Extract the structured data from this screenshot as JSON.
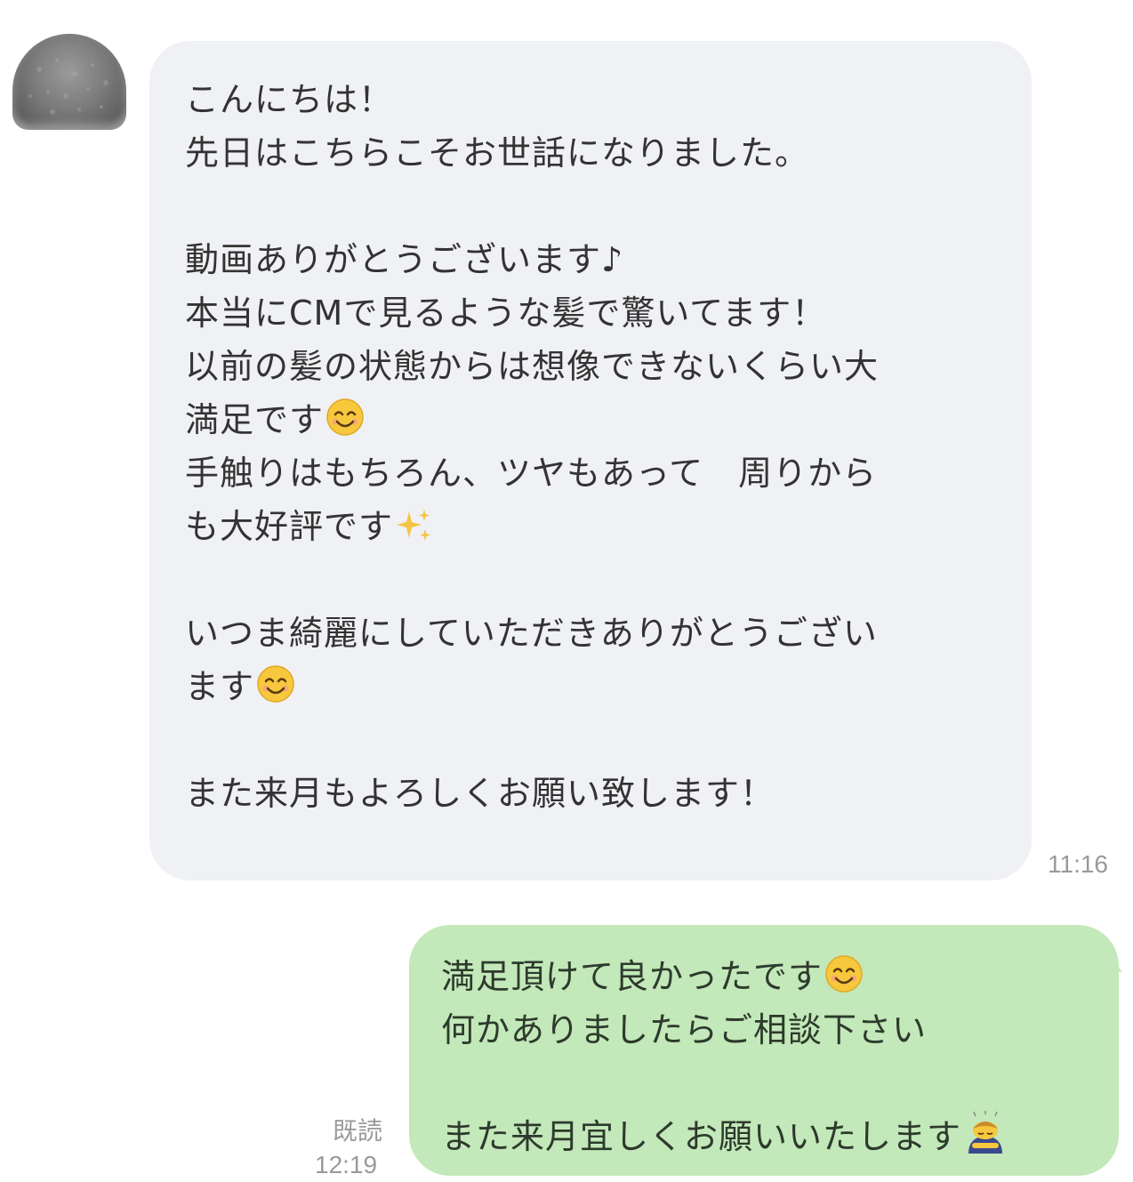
{
  "incoming_message": {
    "lines": [
      "こんにちは！",
      "先日はこちらこそお世話になりました。",
      "",
      "動画ありがとうございます♪",
      "本当にCMで見るような髪で驚いてます！",
      "以前の髪の状態からは想像できないくらい大",
      "満足です",
      "手触りはもちろん、ツヤもあって　周りから",
      "も大好評です",
      "",
      "いつま綺麗にしていただきありがとうござい",
      "ます",
      "",
      "また来月もよろしくお願い致します！"
    ],
    "time": "11:16"
  },
  "outgoing_message": {
    "lines": [
      "満足頂けて良かったです",
      "何かありましたらご相談下さい",
      "",
      "また来月宜しくお願いいたします"
    ],
    "read_label": "既読",
    "time": "12:19"
  },
  "emoji": {
    "smile": "smiling-face-emoji",
    "sparkles": "sparkles-emoji",
    "bow": "bowing-person-emoji"
  },
  "colors": {
    "incoming_bubble": "#f0f1f4",
    "outgoing_bubble": "#c3e8b9",
    "timestamp": "#9a9a9a"
  }
}
